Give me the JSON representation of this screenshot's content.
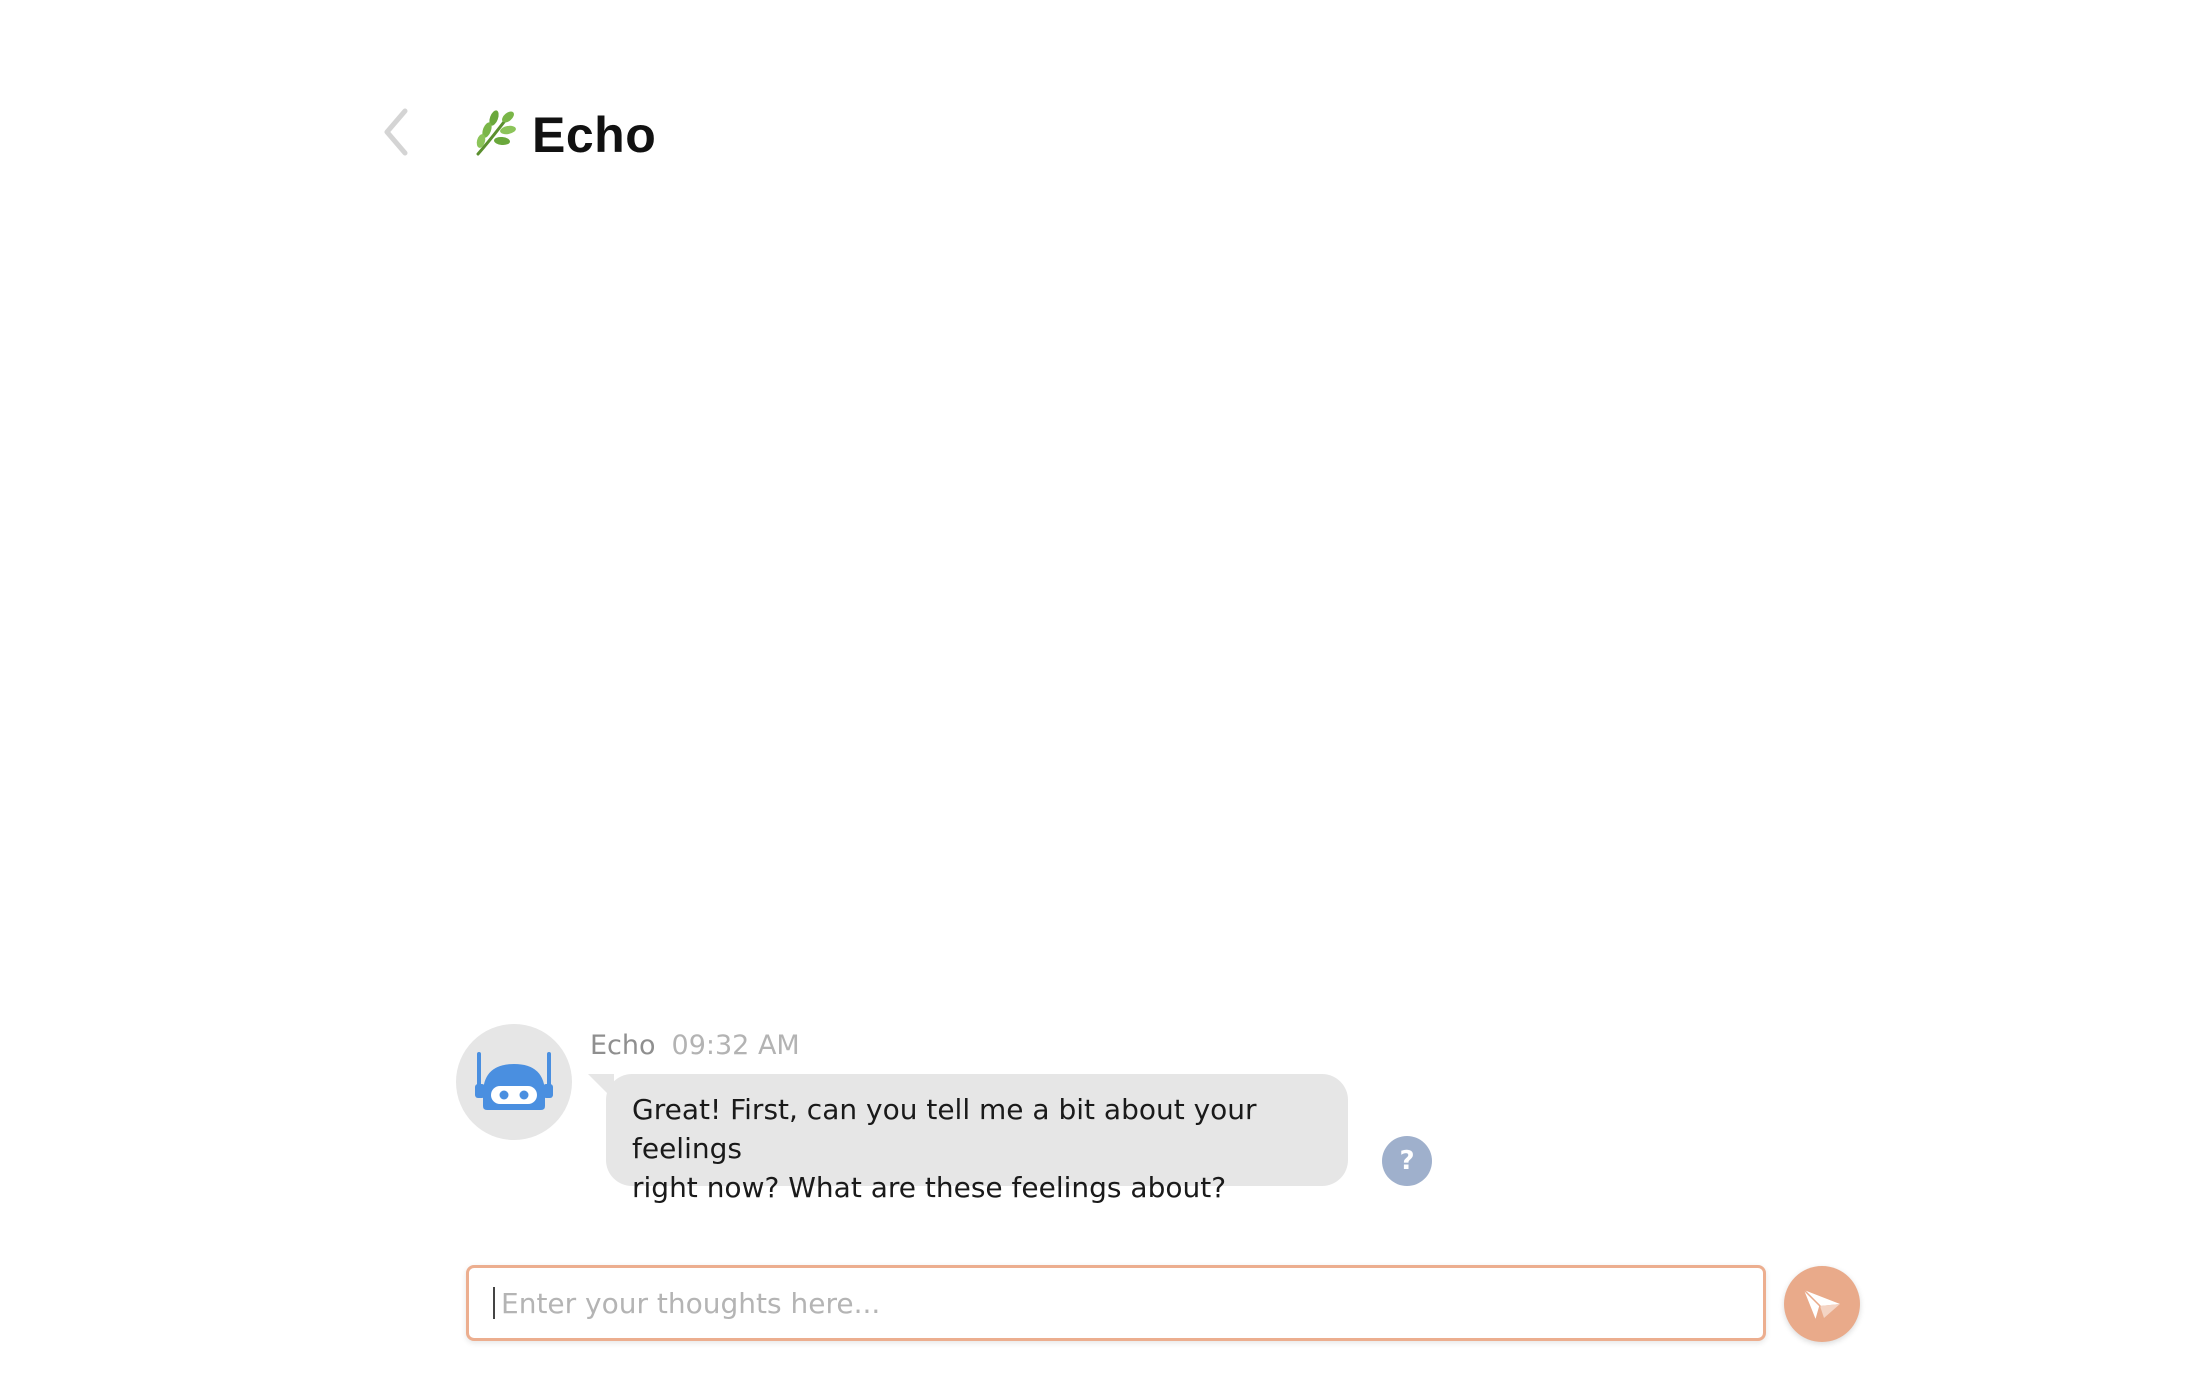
{
  "header": {
    "back_icon": "chevron-left-icon",
    "title_icon": "herb-icon",
    "title_emoji": "🌿",
    "title": "Echo"
  },
  "messages": [
    {
      "sender": "Echo",
      "time": "09:32 AM",
      "avatar_icon": "robot-icon",
      "line1": "Great! First, can you tell me a bit about your feelings",
      "line2": "right now? What are these feelings about?"
    }
  ],
  "help": {
    "icon": "question-icon",
    "label": "?"
  },
  "composer": {
    "placeholder": "Enter your thoughts here...",
    "value": "",
    "send_icon": "paper-plane-icon"
  },
  "colors": {
    "accent": "#e9aa8a",
    "input_border": "#ecae8f",
    "bubble": "#e6e6e6",
    "help": "#9fb0cc",
    "robot": "#4a8fe0"
  }
}
